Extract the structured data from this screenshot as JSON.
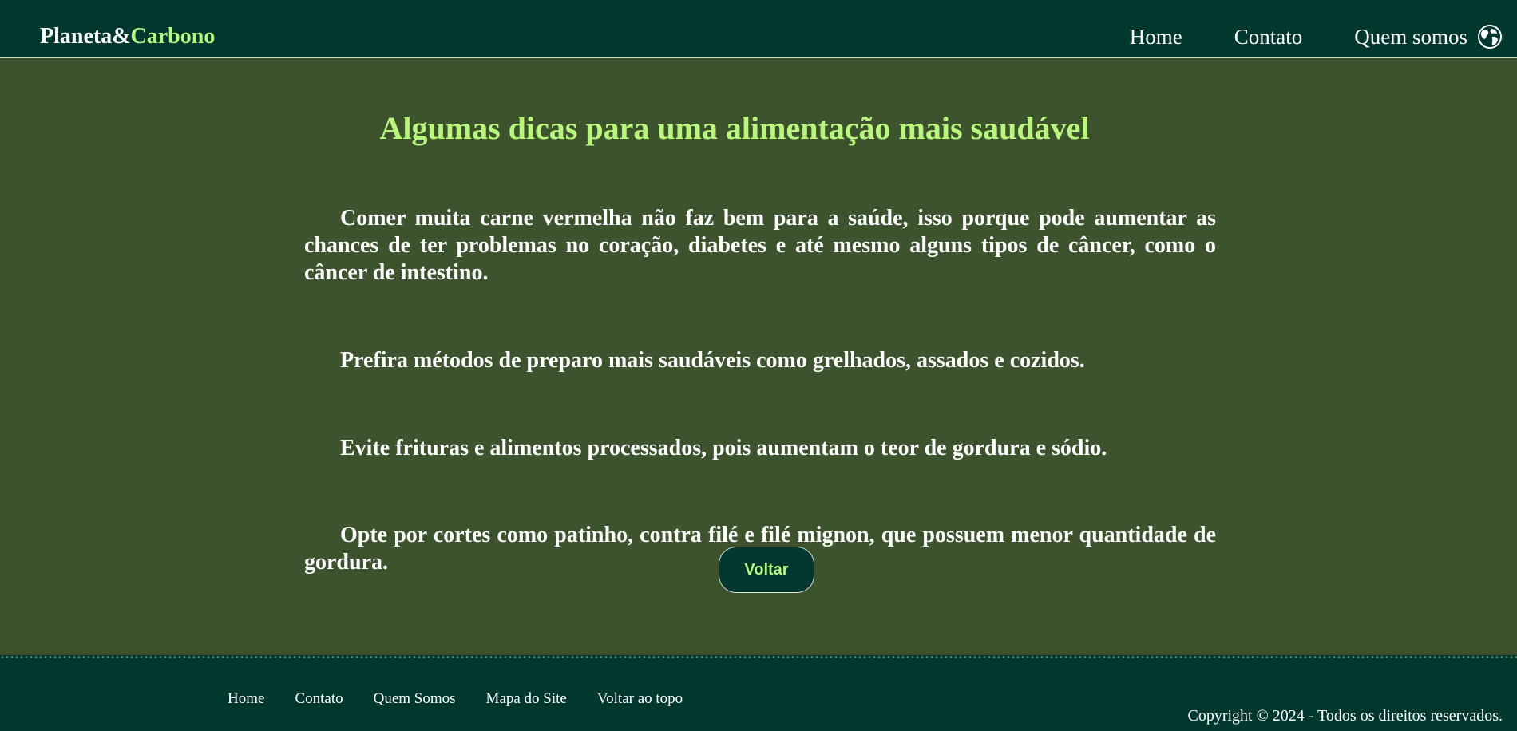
{
  "header": {
    "brand_part1": "Planeta&",
    "brand_part2": "Carbono",
    "nav": [
      "Home",
      "Contato",
      "Quem somos"
    ],
    "globe_icon": "globe-icon"
  },
  "main": {
    "title": "Algumas dicas para uma alimentação mais saudável",
    "tips": [
      "Comer muita carne vermelha não faz bem para a saúde, isso porque pode aumentar as chances de ter problemas no coração, diabetes e até mesmo alguns tipos de câncer, como o câncer de intestino.",
      "Prefira métodos de preparo mais saudáveis como grelhados, assados e cozidos.",
      "Evite frituras e alimentos processados, pois aumentam o teor de gordura e sódio.",
      "Opte por cortes como patinho, contra filé e filé mignon, que possuem menor quantidade de gordura."
    ],
    "button_label": "Voltar"
  },
  "footer": {
    "nav": [
      "Home",
      "Contato",
      "Quem Somos",
      "Mapa do Site",
      "Voltar ao topo"
    ],
    "copyright": "Copyright © 2024 - Todos os direitos reservados."
  },
  "colors": {
    "header_bg": "#003830",
    "page_bg": "#3d532e",
    "accent": "#b9f77c",
    "text": "#ffffff"
  }
}
